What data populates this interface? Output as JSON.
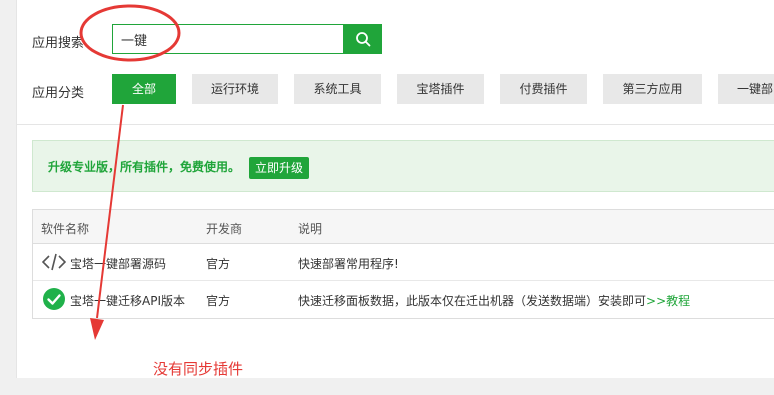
{
  "search": {
    "label": "应用搜索",
    "value": "一键",
    "button_icon": "search-icon"
  },
  "categories": {
    "label": "应用分类",
    "items": [
      {
        "label": "全部",
        "active": true
      },
      {
        "label": "运行环境",
        "active": false
      },
      {
        "label": "系统工具",
        "active": false
      },
      {
        "label": "宝塔插件",
        "active": false
      },
      {
        "label": "付费插件",
        "active": false
      },
      {
        "label": "第三方应用",
        "active": false
      },
      {
        "label": "一键部",
        "active": false
      }
    ]
  },
  "upgrade": {
    "text": "升级专业版，所有插件，免费使用。",
    "button": "立即升级"
  },
  "table": {
    "headers": [
      "软件名称",
      "开发商",
      "说明"
    ],
    "rows": [
      {
        "icon": "code-icon",
        "name": "宝塔一键部署源码",
        "vendor": "官方",
        "desc": "快速部署常用程序!",
        "link": ""
      },
      {
        "icon": "check-circle-icon",
        "name": "宝塔一键迁移API版本",
        "vendor": "官方",
        "desc": "快速迁移面板数据，此版本仅在迁出机器（发送数据端）安装即可",
        "link": ">>教程"
      }
    ]
  },
  "annotation": {
    "note": "没有同步插件"
  },
  "colors": {
    "accent": "#20a53a",
    "annotation": "#e53935"
  }
}
